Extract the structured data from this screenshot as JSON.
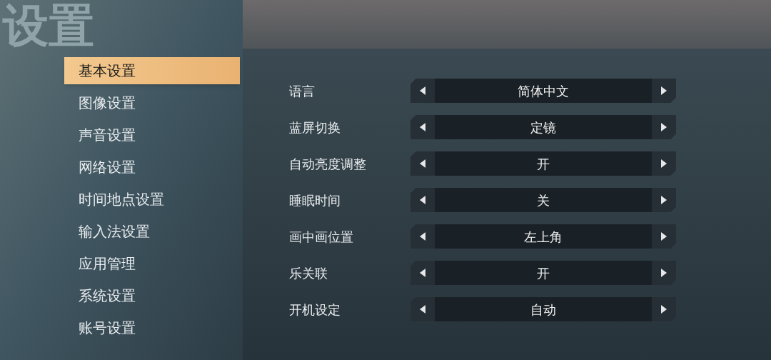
{
  "title": "设置",
  "sidebar": {
    "items": [
      {
        "label": "基本设置",
        "selected": true
      },
      {
        "label": "图像设置",
        "selected": false
      },
      {
        "label": "声音设置",
        "selected": false
      },
      {
        "label": "网络设置",
        "selected": false
      },
      {
        "label": "时间地点设置",
        "selected": false
      },
      {
        "label": "输入法设置",
        "selected": false
      },
      {
        "label": "应用管理",
        "selected": false
      },
      {
        "label": "系统设置",
        "selected": false
      },
      {
        "label": "账号设置",
        "selected": false
      }
    ]
  },
  "settings": [
    {
      "label": "语言",
      "value": "简体中文"
    },
    {
      "label": "蓝屏切换",
      "value": "定镜"
    },
    {
      "label": "自动亮度调整",
      "value": "开"
    },
    {
      "label": "睡眠时间",
      "value": "关"
    },
    {
      "label": "画中画位置",
      "value": "左上角"
    },
    {
      "label": "乐关联",
      "value": "开"
    },
    {
      "label": "开机设定",
      "value": "自动"
    }
  ]
}
